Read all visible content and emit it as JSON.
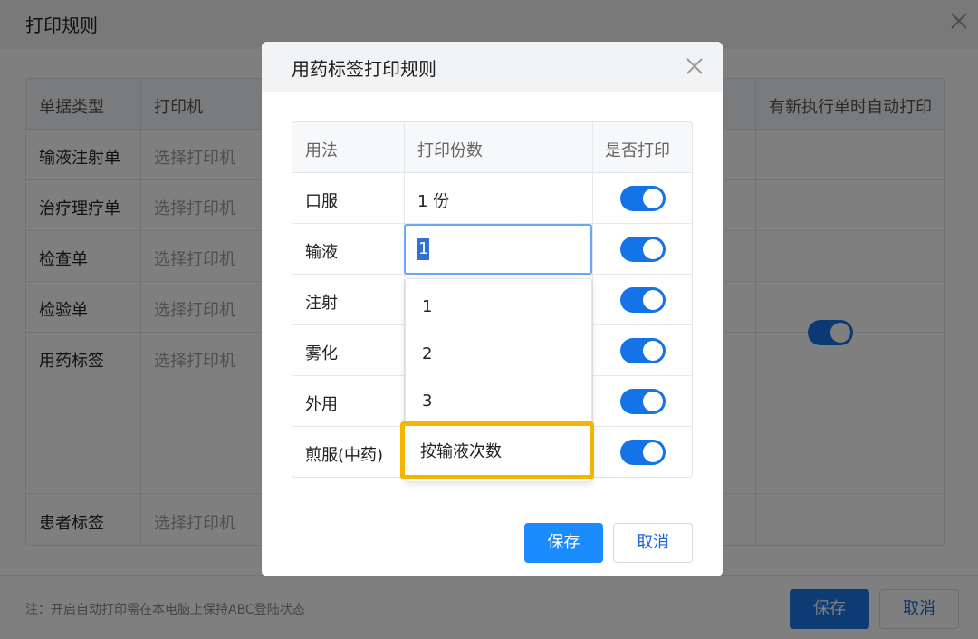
{
  "page": {
    "title": "打印规则",
    "table": {
      "headers": [
        "单据类型",
        "打印机",
        "有新执行单时自动打印"
      ],
      "rows": [
        {
          "type": "输液注射单",
          "printer": "选择打印机"
        },
        {
          "type": "治疗理疗单",
          "printer": "选择打印机"
        },
        {
          "type": "检查单",
          "printer": "选择打印机"
        },
        {
          "type": "检验单",
          "printer": "选择打印机"
        },
        {
          "type": "用药标签",
          "printer": "选择打印机",
          "auto_print": true
        },
        {
          "type": "患者标签",
          "printer": "选择打印机"
        }
      ]
    },
    "footer_note": "注：开启自动打印需在本电脑上保持ABC登陆状态",
    "save_label": "保存",
    "cancel_label": "取消"
  },
  "modal": {
    "title": "用药标签打印规则",
    "headers": [
      "用法",
      "打印份数",
      "是否打印"
    ],
    "rows": [
      {
        "usage": "口服",
        "copies": "1 份",
        "print": true
      },
      {
        "usage": "输液",
        "copies": "1",
        "print": true
      },
      {
        "usage": "注射",
        "copies": "",
        "print": true
      },
      {
        "usage": "雾化",
        "copies": "",
        "print": true
      },
      {
        "usage": "外用",
        "copies": "",
        "print": true
      },
      {
        "usage": "煎服(中药)",
        "copies": "",
        "print": true
      }
    ],
    "input_value": "1",
    "dropdown_options": [
      "1",
      "2",
      "3",
      "按输液次数"
    ],
    "highlighted_option": "按输液次数",
    "save_label": "保存",
    "cancel_label": "取消"
  },
  "colors": {
    "primary": "#1a8cff",
    "toggle_on": "#1473e6",
    "highlight": "#f5b400"
  }
}
